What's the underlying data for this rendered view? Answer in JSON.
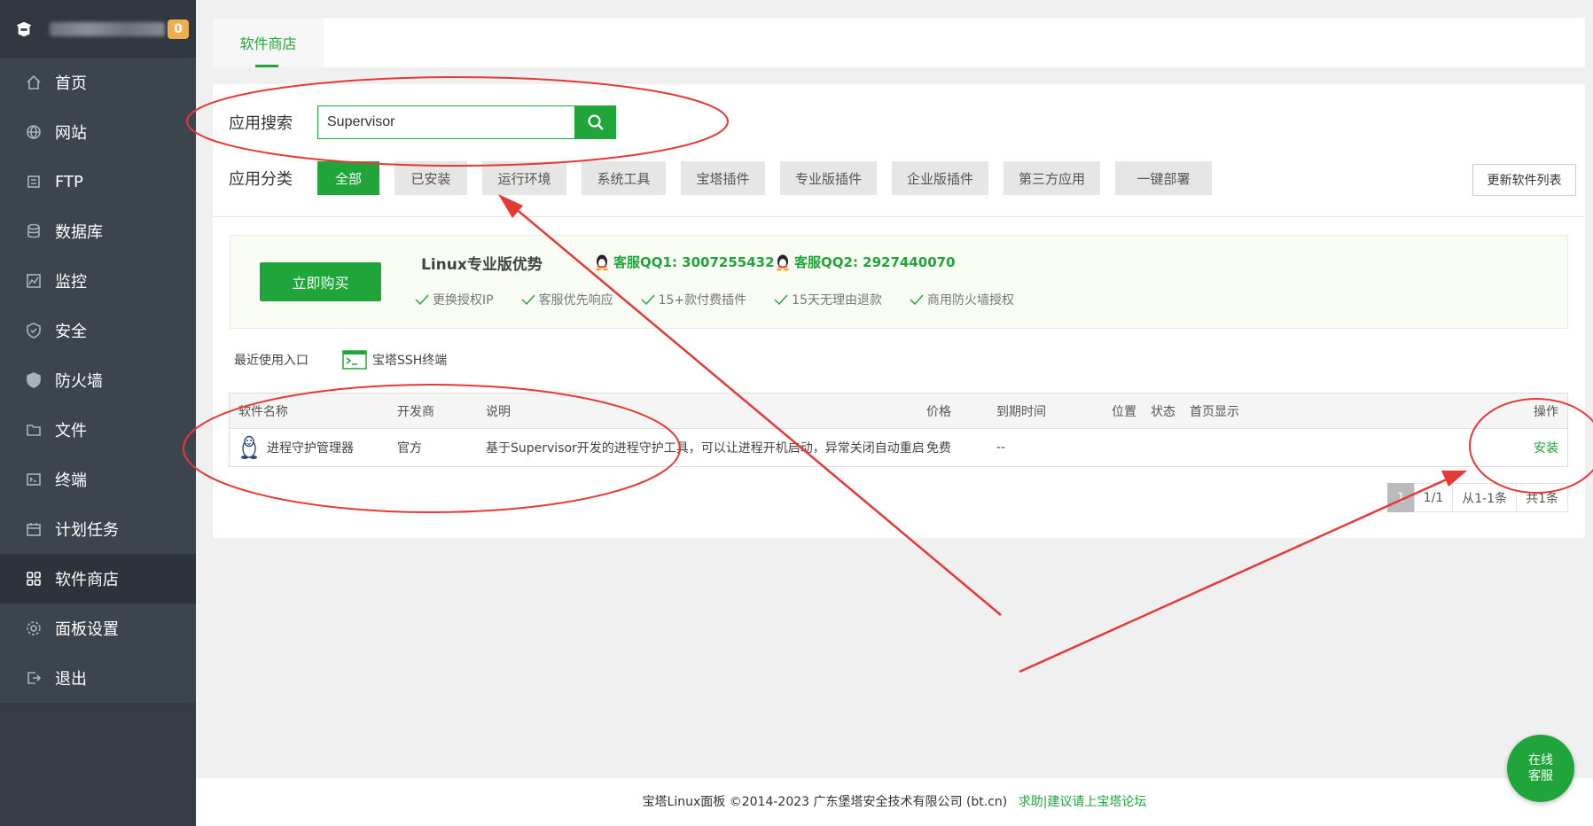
{
  "sidebar": {
    "badge": "0",
    "items": [
      {
        "label": "首页",
        "icon": "home-icon"
      },
      {
        "label": "网站",
        "icon": "globe-icon"
      },
      {
        "label": "FTP",
        "icon": "ftp-icon"
      },
      {
        "label": "数据库",
        "icon": "database-icon"
      },
      {
        "label": "监控",
        "icon": "monitor-icon"
      },
      {
        "label": "安全",
        "icon": "shield-check-icon"
      },
      {
        "label": "防火墙",
        "icon": "firewall-icon"
      },
      {
        "label": "文件",
        "icon": "folder-icon"
      },
      {
        "label": "终端",
        "icon": "terminal-icon"
      },
      {
        "label": "计划任务",
        "icon": "calendar-icon"
      },
      {
        "label": "软件商店",
        "icon": "grid-icon",
        "active": true
      },
      {
        "label": "面板设置",
        "icon": "settings-icon"
      },
      {
        "label": "退出",
        "icon": "logout-icon"
      }
    ]
  },
  "tabs": {
    "store": "软件商店"
  },
  "search": {
    "label": "应用搜索",
    "value": "Supervisor"
  },
  "categories": {
    "label": "应用分类",
    "items": [
      "全部",
      "已安装",
      "运行环境",
      "系统工具",
      "宝塔插件",
      "专业版插件",
      "企业版插件",
      "第三方应用",
      "一键部署"
    ],
    "refresh": "更新软件列表"
  },
  "promo": {
    "buy": "立即购买",
    "title": "Linux专业版优势",
    "qq1": "客服QQ1: 3007255432",
    "qq2": "客服QQ2: 2927440070",
    "features": [
      "更换授权IP",
      "客服优先响应",
      "15+款付费插件",
      "15天无理由退款",
      "商用防火墙授权"
    ]
  },
  "recent": {
    "label": "最近使用入口",
    "item": "宝塔SSH终端"
  },
  "table": {
    "headers": {
      "name": "软件名称",
      "dev": "开发商",
      "desc": "说明",
      "price": "价格",
      "expire": "到期时间",
      "pos": "位置",
      "status": "状态",
      "home": "首页显示",
      "ops": "操作"
    },
    "row": {
      "name": "进程守护管理器",
      "dev": "官方",
      "desc": "基于Supervisor开发的进程守护工具，可以让进程开机启动，异常关闭自动重启",
      "price": "免费",
      "expire": "--",
      "action": "安装"
    }
  },
  "pager": {
    "current": "1",
    "total_pages": "1/1",
    "range": "从1-1条",
    "count": "共1条"
  },
  "footer": {
    "copyright": "宝塔Linux面板 ©2014-2023 广东堡塔安全技术有限公司 (bt.cn)",
    "link": "求助|建议请上宝塔论坛"
  },
  "online_service": {
    "line1": "在线",
    "line2": "客服"
  },
  "colors": {
    "accent": "#20a53a",
    "sidebar": "#3c444d",
    "annotation": "#e53935"
  }
}
